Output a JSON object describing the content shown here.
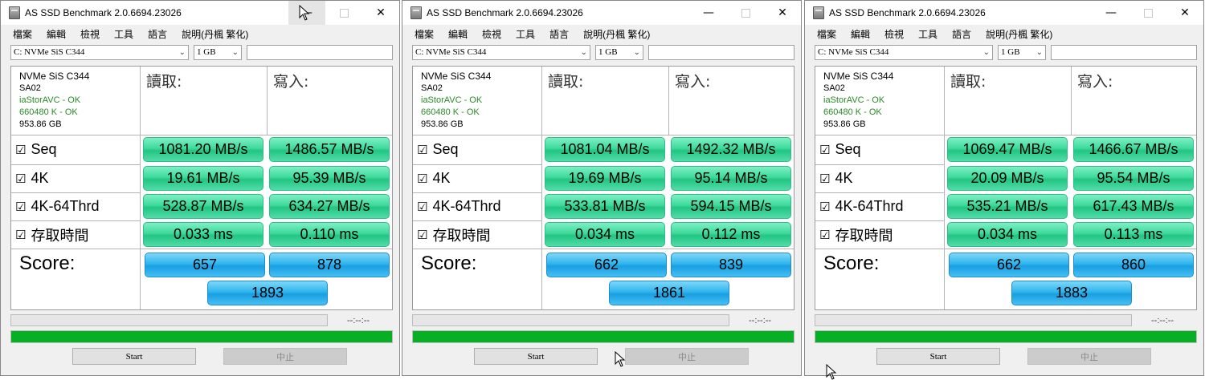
{
  "windows": [
    {
      "title": "AS SSD Benchmark 2.0.6694.23026",
      "menu": [
        "檔案",
        "編輯",
        "檢視",
        "工具",
        "語言",
        "說明(丹楓 繁化)"
      ],
      "drive_select": "C: NVMe SiS C344",
      "size_select": "1 GB",
      "info": {
        "model": "NVMe SiS C344",
        "firmware": "SA02",
        "driver": "iaStorAVC - OK",
        "align": "660480 K - OK",
        "capacity": "953.86 GB"
      },
      "read_label": "讀取:",
      "write_label": "寫入:",
      "rows": [
        {
          "label": "Seq",
          "read": "1081.20 MB/s",
          "write": "1486.57 MB/s"
        },
        {
          "label": "4K",
          "read": "19.61 MB/s",
          "write": "95.39 MB/s"
        },
        {
          "label": "4K-64Thrd",
          "read": "528.87 MB/s",
          "write": "634.27 MB/s"
        },
        {
          "label": "存取時間",
          "read": "0.033 ms",
          "write": "0.110 ms"
        }
      ],
      "score_label": "Score:",
      "score_read": "657",
      "score_write": "878",
      "score_total": "1893",
      "time": "--:--:--",
      "progress": 1.0,
      "start_label": "Start",
      "stop_label": "中止"
    },
    {
      "title": "AS SSD Benchmark 2.0.6694.23026",
      "menu": [
        "檔案",
        "編輯",
        "檢視",
        "工具",
        "語言",
        "說明(丹楓 繁化)"
      ],
      "drive_select": "C: NVMe SiS C344",
      "size_select": "1 GB",
      "info": {
        "model": "NVMe SiS C344",
        "firmware": "SA02",
        "driver": "iaStorAVC - OK",
        "align": "660480 K - OK",
        "capacity": "953.86 GB"
      },
      "read_label": "讀取:",
      "write_label": "寫入:",
      "rows": [
        {
          "label": "Seq",
          "read": "1081.04 MB/s",
          "write": "1492.32 MB/s"
        },
        {
          "label": "4K",
          "read": "19.69 MB/s",
          "write": "95.14 MB/s"
        },
        {
          "label": "4K-64Thrd",
          "read": "533.81 MB/s",
          "write": "594.15 MB/s"
        },
        {
          "label": "存取時間",
          "read": "0.034 ms",
          "write": "0.112 ms"
        }
      ],
      "score_label": "Score:",
      "score_read": "662",
      "score_write": "839",
      "score_total": "1861",
      "time": "--:--:--",
      "progress": 1.0,
      "start_label": "Start",
      "stop_label": "中止"
    },
    {
      "title": "AS SSD Benchmark 2.0.6694.23026",
      "menu": [
        "檔案",
        "編輯",
        "檢視",
        "工具",
        "語言",
        "說明(丹楓 繁化)"
      ],
      "drive_select": "C: NVMe SiS C344",
      "size_select": "1 GB",
      "info": {
        "model": "NVMe SiS C344",
        "firmware": "SA02",
        "driver": "iaStorAVC - OK",
        "align": "660480 K - OK",
        "capacity": "953.86 GB"
      },
      "read_label": "讀取:",
      "write_label": "寫入:",
      "rows": [
        {
          "label": "Seq",
          "read": "1069.47 MB/s",
          "write": "1466.67 MB/s"
        },
        {
          "label": "4K",
          "read": "20.09 MB/s",
          "write": "95.54 MB/s"
        },
        {
          "label": "4K-64Thrd",
          "read": "535.21 MB/s",
          "write": "617.43 MB/s"
        },
        {
          "label": "存取時間",
          "read": "0.034 ms",
          "write": "0.113 ms"
        }
      ],
      "score_label": "Score:",
      "score_read": "662",
      "score_write": "860",
      "score_total": "1883",
      "time": "--:--:--",
      "progress": 1.0,
      "start_label": "Start",
      "stop_label": "中止"
    }
  ],
  "icons": {
    "minimize": "minimize-icon",
    "maximize": "maximize-icon",
    "close": "close-icon",
    "checkbox": "checkbox-checked-icon",
    "dropdown": "chevron-down-icon",
    "cursor": "mouse-pointer-icon"
  },
  "colors": {
    "result_cell": "#3fd99b",
    "score_cell": "#2fb4ee",
    "progress_fill": "#06b025"
  }
}
